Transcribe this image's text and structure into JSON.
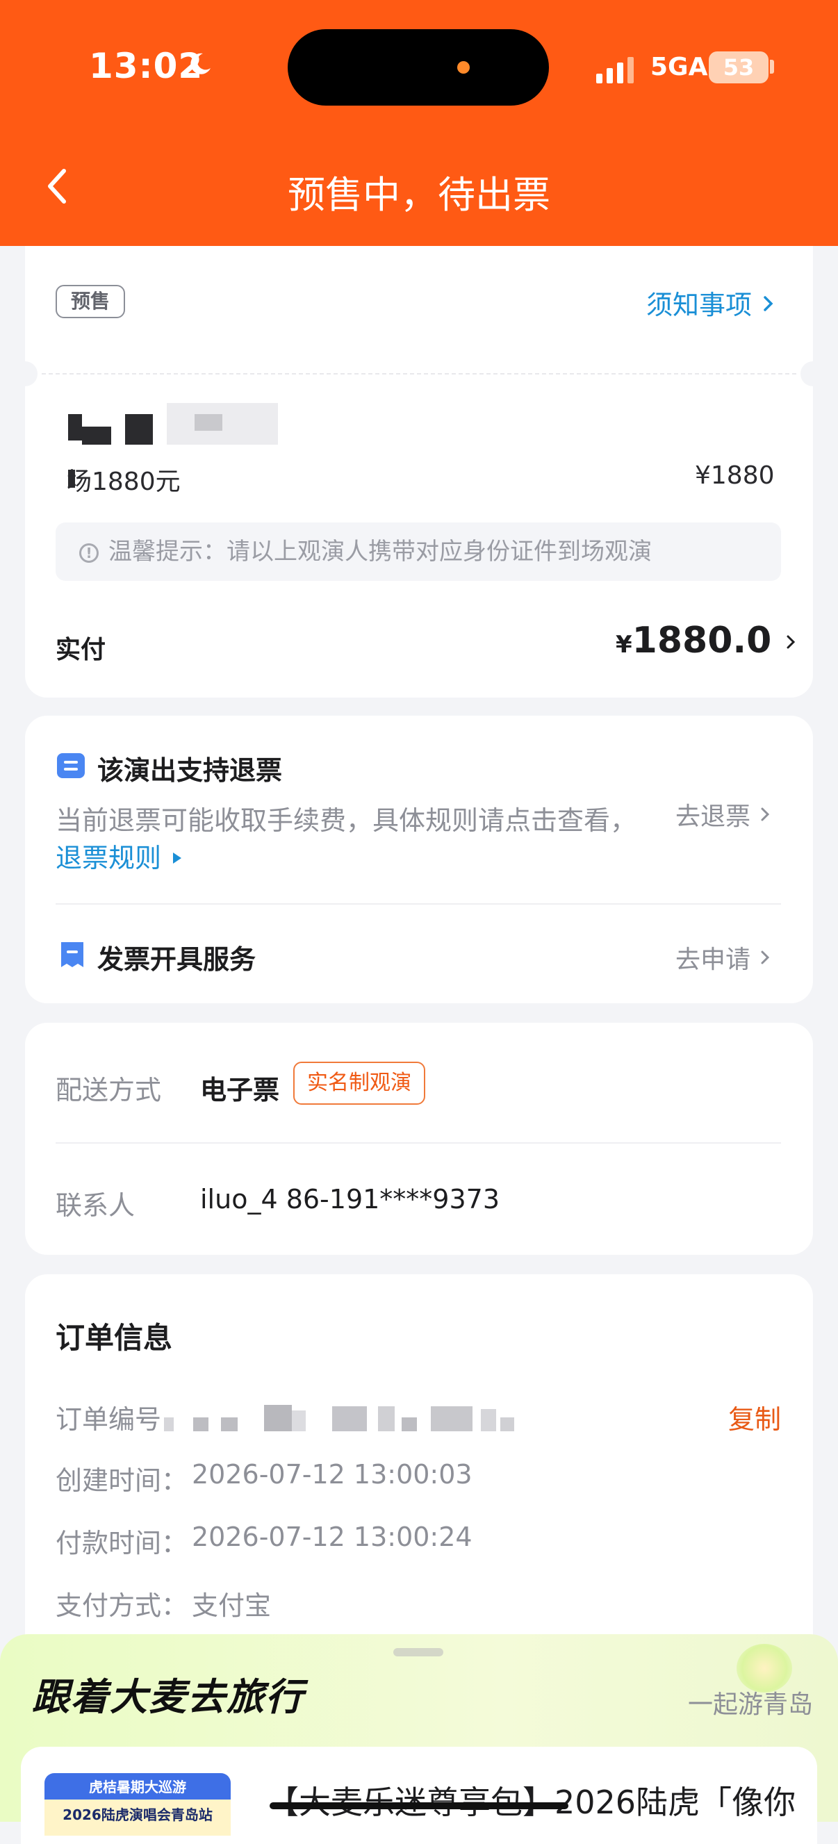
{
  "status_bar": {
    "time": "13:02",
    "network": "5GA",
    "battery": "53"
  },
  "nav": {
    "title": "预售中，待出票"
  },
  "ticket": {
    "presale_tag": "预售",
    "notice_link": "须知事项",
    "seat_desc": "场1880元",
    "seat_price": "¥1880",
    "tip": "温馨提示：请以上观演人携带对应身份证件到场观演",
    "paid_label": "实付",
    "paid_currency": "¥",
    "paid_amount": "1880.0"
  },
  "refund": {
    "title": "该演出支持退票",
    "desc": "当前退票可能收取手续费，具体规则请点击查看，",
    "rule_link": "退票规则",
    "go_refund": "去退票",
    "invoice_title": "发票开具服务",
    "go_apply": "去申请"
  },
  "delivery": {
    "method_label": "配送方式",
    "method_value": "电子票",
    "realname_tag": "实名制观演",
    "contact_label": "联系人",
    "contact_value": "iluo_4  86-191****9373"
  },
  "order": {
    "title": "订单信息",
    "number_label": "订单编号",
    "copy": "复制",
    "created_label": "创建时间：",
    "created_value": "2026-07-12 13:00:03",
    "paid_label": "付款时间：",
    "paid_value": "2026-07-12 13:00:24",
    "pay_method_label": "支付方式：",
    "pay_method_value": "支付宝"
  },
  "promo": {
    "title": "跟着大麦去旅行",
    "right": "一起游青岛",
    "img_line1": "虎桔暑期大巡游",
    "img_line2": "2026陆虎演唱会青岛站",
    "item_text": "【大麦乐迷尊享包】2026陆虎「像你"
  },
  "icons": [
    "back-chevron-icon",
    "moon-icon",
    "signal-icon",
    "info-icon",
    "refund-ticket-icon",
    "invoice-icon",
    "chevron-right-icon"
  ],
  "colors": {
    "brand": "#ff5a14",
    "link": "#1a8fd6",
    "accent_orange": "#e85a16"
  }
}
